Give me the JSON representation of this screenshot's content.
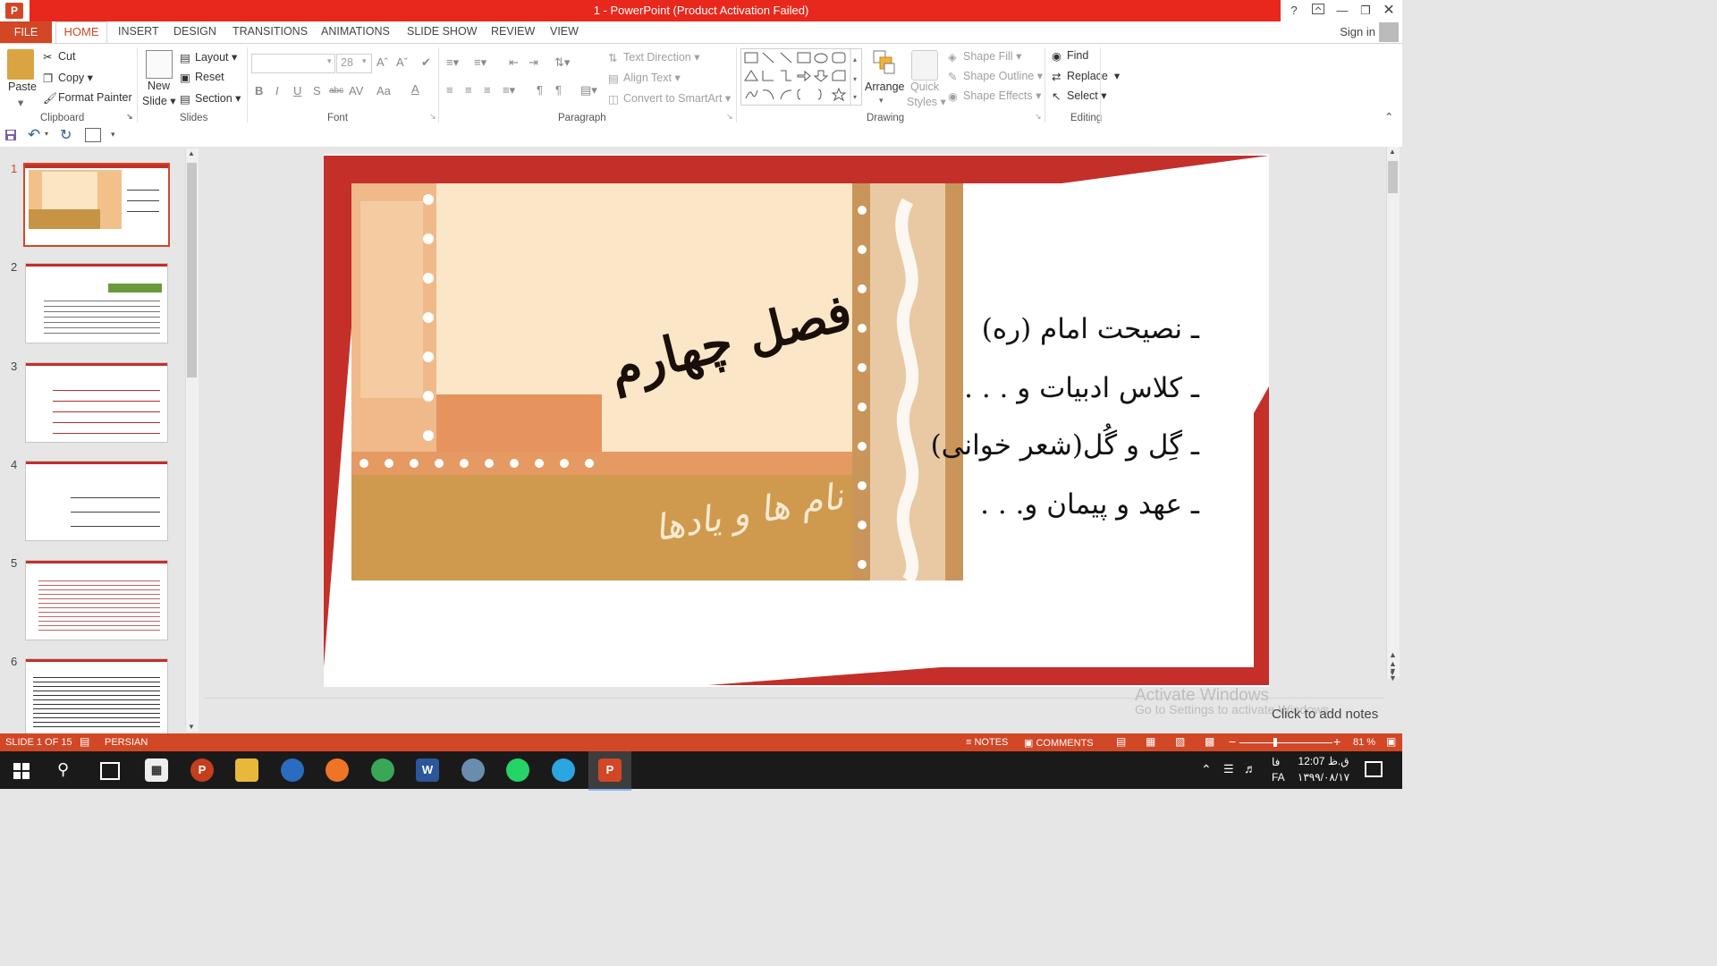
{
  "window": {
    "title": "1 -  PowerPoint (Product Activation Failed)",
    "help": "?",
    "signin": "Sign in"
  },
  "tabs": {
    "file": "FILE",
    "home": "HOME",
    "insert": "INSERT",
    "design": "DESIGN",
    "transitions": "TRANSITIONS",
    "animations": "ANIMATIONS",
    "slideshow": "SLIDE SHOW",
    "review": "REVIEW",
    "view": "VIEW"
  },
  "clipboard": {
    "paste": "Paste",
    "cut": "Cut",
    "copy": "Copy",
    "format_painter": "Format Painter",
    "label": "Clipboard"
  },
  "slides_group": {
    "new_slide_1": "New",
    "new_slide_2": "Slide",
    "layout": "Layout",
    "reset": "Reset",
    "section": "Section",
    "label": "Slides"
  },
  "font": {
    "size": "28",
    "label": "Font"
  },
  "paragraph": {
    "text_direction": "Text Direction",
    "align_text": "Align Text",
    "convert_smartart": "Convert to SmartArt",
    "label": "Paragraph"
  },
  "drawing": {
    "arrange": "Arrange",
    "quick_styles_1": "Quick",
    "quick_styles_2": "Styles",
    "shape_fill": "Shape Fill",
    "shape_outline": "Shape Outline",
    "shape_effects": "Shape Effects",
    "label": "Drawing"
  },
  "editing": {
    "find": "Find",
    "replace": "Replace",
    "select": "Select",
    "label": "Editing"
  },
  "thumbnails": [
    "1",
    "2",
    "3",
    "4",
    "5",
    "6"
  ],
  "slide": {
    "title": "فصل چهارم",
    "subtitle": "نام ها و یادها",
    "bullets": [
      "ـ نصیحت امام (ره)",
      "ـ کلاس ادبیات و . . .",
      "ـ گِل و گُل(شعر خوانی)",
      "ـ عهد و پیمان و. . ."
    ]
  },
  "notes": {
    "placeholder": "Click to add notes",
    "watermark_1": "Activate Windows",
    "watermark_2": "Go to Settings to activate Windows."
  },
  "status": {
    "slide_info": "SLIDE 1 OF 15",
    "language": "PERSIAN",
    "notes": "NOTES",
    "comments": "COMMENTS",
    "zoom": "81 %"
  },
  "taskbar": {
    "time": "12:07 ق.ظ",
    "date": "۱۳۹۹/۰۸/۱۷",
    "lang_top": "فا",
    "lang_bottom": "FA"
  },
  "colors": {
    "accent": "#d24726",
    "titlebar": "#e8281c",
    "slide_red": "#c42f2a",
    "slide_tan": "#cf9a4e"
  }
}
